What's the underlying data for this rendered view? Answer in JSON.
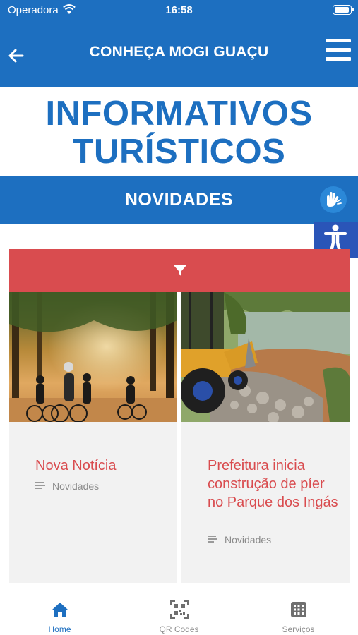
{
  "status_bar": {
    "carrier": "Operadora",
    "time": "16:58"
  },
  "header": {
    "title": "CONHEÇA MOGI GUAÇU",
    "back_icon": "arrow-left-icon",
    "menu_icon": "hamburger-menu-icon"
  },
  "headline": {
    "line1": "INFORMATIVOS",
    "line2": "TURÍSTICOS"
  },
  "section": {
    "label": "NOVIDADES"
  },
  "accessibility": {
    "sign_language_icon": "sign-language-hands-icon",
    "accessibility_icon": "accessibility-person-icon"
  },
  "filter": {
    "icon": "filter-icon"
  },
  "cards": [
    {
      "title": "Nova Notícia",
      "category": "Novidades",
      "image": "cyclists-forest-photo"
    },
    {
      "title": "Prefeitura inicia construção de píer no Parque dos Ingás",
      "category": "Novidades",
      "image": "excavator-lake-photo"
    }
  ],
  "tabbar": {
    "tabs": [
      {
        "label": "Home",
        "icon": "home-icon",
        "active": true
      },
      {
        "label": "QR Codes",
        "icon": "qr-code-icon",
        "active": false
      },
      {
        "label": "Serviços",
        "icon": "grid-icon",
        "active": false
      }
    ]
  },
  "colors": {
    "primary": "#1d6fc0",
    "accent_red": "#d94c4f",
    "card_bg": "#f2f2f2"
  }
}
